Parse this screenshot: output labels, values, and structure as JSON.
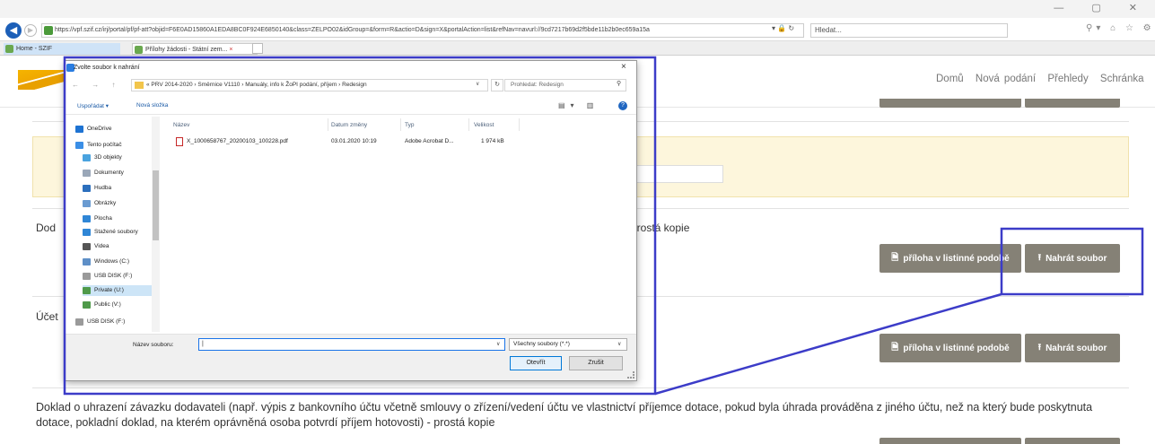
{
  "browser": {
    "url": "https://vpf.szif.cz/irj/portal/pf/pf-att?objid=F6E0AD15860A1EDA8BC0F924E6850140&class=ZELPO02&idGroup=&form=R&actio=D&sign=X&portalAction=list&refNav=navurl://9cd7217b69d2f5bde11b2b0ec659a15a",
    "search_placeholder": "Hledat...",
    "tabs": [
      {
        "label": "Home - SZIF"
      },
      {
        "label": "Přílohy žádosti - Státní zem..."
      }
    ],
    "tab_close": "×"
  },
  "page": {
    "nav": [
      "Domů",
      "Nová podání",
      "Přehledy",
      "Schránka"
    ],
    "section_dod_prefix": "Dod",
    "section_dod_suffix": "prostá kopie",
    "section_ucet_prefix": "Účet",
    "buttons": {
      "paper_attachment": "příloha v listinné podobě",
      "upload_file": "Nahrát soubor"
    },
    "long_text": "Doklad o uhrazení závazku dodavateli (např. výpis z bankovního účtu včetně smlouvy o zřízení/vedení účtu ve vlastnictví příjemce dotace, pokud byla úhrada prováděna z jiného účtu, než na který bude poskytnuta dotace, pokladní doklad, na kterém oprávněná osoba potvrdí příjem hotovosti) - prostá kopie"
  },
  "dialog": {
    "title": "Zvolte soubor k nahrání",
    "close": "×",
    "nav_buttons": "← → ↑",
    "path": "« PRV 2014-2020 › Směrnice V1110 › Manuály, info k ŽoPI podání, příjem › Redesign",
    "search_placeholder": "Prohledat: Redesign",
    "toolbar": {
      "organize": "Uspořádat ▾",
      "new_folder": "Nová složka"
    },
    "help": "?",
    "tree": [
      {
        "label": "OneDrive",
        "color": "#1e73d2"
      },
      {
        "label": "Tento počítač",
        "color": "#3a8ee6"
      },
      {
        "label": "3D objekty",
        "color": "#4aa3df"
      },
      {
        "label": "Dokumenty",
        "color": "#9aa7b8"
      },
      {
        "label": "Hudba",
        "color": "#2c6fbd"
      },
      {
        "label": "Obrázky",
        "color": "#6a9bd1"
      },
      {
        "label": "Plocha",
        "color": "#2f86d6"
      },
      {
        "label": "Stažené soubory",
        "color": "#2f86d6"
      },
      {
        "label": "Videa",
        "color": "#555555"
      },
      {
        "label": "Windows (C:)",
        "color": "#5e8fc7"
      },
      {
        "label": "USB DISK (F:)",
        "color": "#9a9a9a"
      },
      {
        "label": "Private (U:)",
        "color": "#4f9a4a"
      },
      {
        "label": "Public (V:)",
        "color": "#4f9a4a"
      },
      {
        "label": "USB DISK (F:)",
        "color": "#9a9a9a"
      }
    ],
    "columns": {
      "name": "Název",
      "date": "Datum změny",
      "type": "Typ",
      "size": "Velikost"
    },
    "files": [
      {
        "name": "X_1000658767_20200103_100228.pdf",
        "date": "03.01.2020 10:19",
        "type": "Adobe Acrobat D...",
        "size": "1 974 kB"
      }
    ],
    "filename_label": "Název souboru:",
    "filetype": "Všechny soubory (*.*)",
    "open_button": "Otevřít",
    "cancel_button": "Zrušit"
  },
  "colors": {
    "annotation": "#3c3cc8",
    "button_grey": "#858176",
    "yellow_box": "#fdf6dc"
  }
}
